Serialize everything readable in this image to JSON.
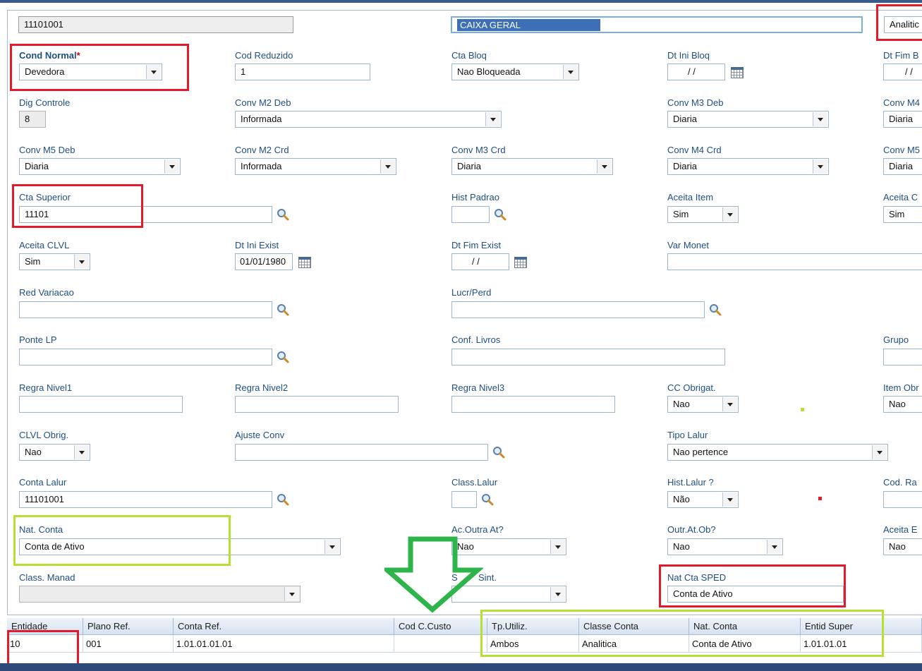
{
  "header": {
    "conta": "11101001",
    "descricao": "CAIXA GERAL",
    "classe": "Analitic"
  },
  "fields": {
    "cond_normal": {
      "label": "Cond Normal",
      "req": "*",
      "value": "Devedora"
    },
    "cod_reduzido": {
      "label": "Cod Reduzido",
      "value": "1"
    },
    "cta_bloq": {
      "label": "Cta Bloq",
      "value": "Nao Bloqueada"
    },
    "dt_ini_bloq": {
      "label": "Dt Ini Bloq",
      "value": "/ /"
    },
    "dt_fim_bloq": {
      "label": "Dt Fim B",
      "value": "/ /"
    },
    "dig_controle": {
      "label": "Dig Controle",
      "value": "8"
    },
    "conv_m2_deb": {
      "label": "Conv M2 Deb",
      "value": "Informada"
    },
    "conv_m3_deb": {
      "label": "Conv M3 Deb",
      "value": "Diaria"
    },
    "conv_m4_deb": {
      "label": "Conv M4",
      "value": "Diaria"
    },
    "conv_m5_deb": {
      "label": "Conv M5 Deb",
      "value": "Diaria"
    },
    "conv_m2_crd": {
      "label": "Conv M2 Crd",
      "value": "Informada"
    },
    "conv_m3_crd": {
      "label": "Conv M3 Crd",
      "value": "Diaria"
    },
    "conv_m4_crd": {
      "label": "Conv M4 Crd",
      "value": "Diaria"
    },
    "conv_m5_crd": {
      "label": "Conv M5",
      "value": "Diaria"
    },
    "cta_superior": {
      "label": "Cta Superior",
      "value": "11101"
    },
    "hist_padrao": {
      "label": "Hist Padrao",
      "value": ""
    },
    "aceita_item": {
      "label": "Aceita Item",
      "value": "Sim"
    },
    "aceita_cc": {
      "label": "Aceita C",
      "value": "Sim"
    },
    "aceita_clvl": {
      "label": "Aceita CLVL",
      "value": "Sim"
    },
    "dt_ini_exist": {
      "label": "Dt Ini Exist",
      "value": "01/01/1980"
    },
    "dt_fim_exist": {
      "label": "Dt Fim Exist",
      "value": "/ /"
    },
    "var_monet": {
      "label": "Var Monet",
      "value": ""
    },
    "red_variacao": {
      "label": "Red Variacao",
      "value": ""
    },
    "lucr_perd": {
      "label": "Lucr/Perd",
      "value": ""
    },
    "ponte_lp": {
      "label": "Ponte LP",
      "value": ""
    },
    "conf_livros": {
      "label": "Conf. Livros",
      "value": ""
    },
    "grupo": {
      "label": "Grupo",
      "value": ""
    },
    "regra_nivel1": {
      "label": "Regra Nivel1",
      "value": ""
    },
    "regra_nivel2": {
      "label": "Regra Nivel2",
      "value": ""
    },
    "regra_nivel3": {
      "label": "Regra Nivel3",
      "value": ""
    },
    "cc_obrigat": {
      "label": "CC Obrigat.",
      "value": "Nao"
    },
    "item_obrig": {
      "label": "Item Obr",
      "value": "Nao"
    },
    "clvl_obrig": {
      "label": "CLVL Obrig.",
      "value": "Nao"
    },
    "ajuste_conv": {
      "label": "Ajuste Conv",
      "value": ""
    },
    "tipo_lalur": {
      "label": "Tipo Lalur",
      "value": "Nao pertence"
    },
    "conta_lalur": {
      "label": "Conta Lalur",
      "value": "11101001"
    },
    "class_lalur": {
      "label": "Class.Lalur",
      "value": ""
    },
    "hist_lalur": {
      "label": "Hist.Lalur ?",
      "value": "Não"
    },
    "cod_ra": {
      "label": "Cod. Ra",
      "value": ""
    },
    "nat_conta": {
      "label": "Nat. Conta",
      "value": "Conta de Ativo"
    },
    "ac_outra_at": {
      "label": "Ac.Outra At?",
      "value": "Nao"
    },
    "outr_at_ob": {
      "label": "Outr.At.Ob?",
      "value": "Nao"
    },
    "aceita_e": {
      "label": "Aceita E",
      "value": "Nao"
    },
    "class_manad": {
      "label": "Class. Manad",
      "value": ""
    },
    "sped_sint": {
      "label_left": "S",
      "label_right": "Sint.",
      "value": ""
    },
    "nat_cta_sped": {
      "label": "Nat Cta SPED",
      "value": "Conta de Ativo"
    }
  },
  "grid": {
    "columns": [
      "Entidade",
      "Plano Ref.",
      "Conta Ref.",
      "Cod C.Custo",
      "Tp.Utiliz.",
      "Classe Conta",
      "Nat. Conta",
      "Entid Super"
    ],
    "rows": [
      [
        "10",
        "001",
        "1.01.01.01.01",
        "",
        "Ambos",
        "Analitica",
        "Conta de Ativo",
        "1.01.01.01"
      ]
    ]
  },
  "colors": {
    "label": "#1f4e82",
    "highlight_red": "#e11b2b",
    "highlight_lime": "#b7e032",
    "arrow_green": "#2db44a",
    "selection": "#3d6fb6"
  },
  "icons": [
    "search-icon",
    "calendar-icon",
    "dropdown-arrow-icon",
    "down-arrow-annotation"
  ]
}
